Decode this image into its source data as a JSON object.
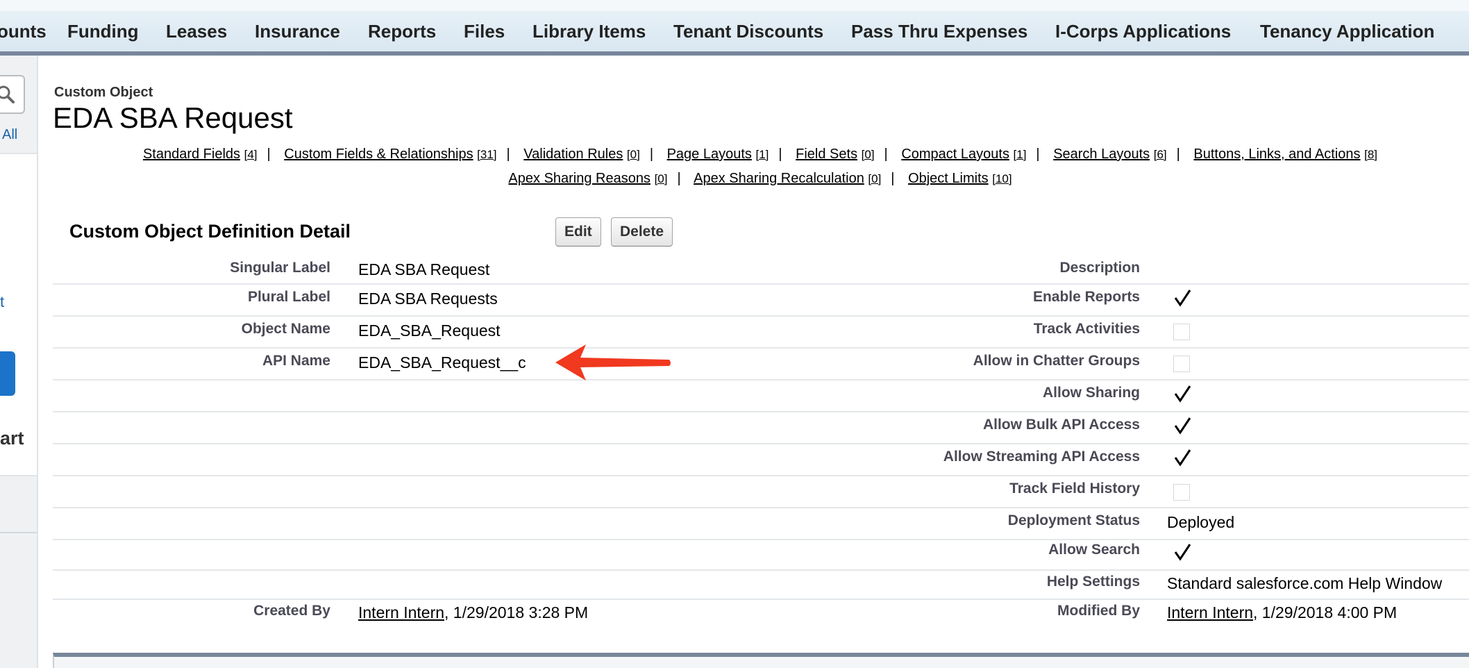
{
  "tabs": [
    "ounts",
    "Funding",
    "Leases",
    "Insurance",
    "Reports",
    "Files",
    "Library Items",
    "Tenant Discounts",
    "Pass Thru Expenses",
    "I-Corps Applications",
    "Tenancy Application"
  ],
  "sidebar": {
    "all_label": "All",
    "t_label": "t",
    "art_label": "art"
  },
  "header": {
    "crumb": "Custom Object",
    "title": "EDA SBA Request"
  },
  "related_links": [
    {
      "label": "Standard Fields",
      "count": "[4]"
    },
    {
      "label": "Custom Fields & Relationships",
      "count": "[31]"
    },
    {
      "label": "Validation Rules",
      "count": "[0]"
    },
    {
      "label": "Page Layouts",
      "count": "[1]"
    },
    {
      "label": "Field Sets",
      "count": "[0]"
    },
    {
      "label": "Compact Layouts",
      "count": "[1]"
    },
    {
      "label": "Search Layouts",
      "count": "[6]"
    },
    {
      "label": "Buttons, Links, and Actions",
      "count": "[8]"
    },
    {
      "label": "Apex Sharing Reasons",
      "count": "[0]"
    },
    {
      "label": "Apex Sharing Recalculation",
      "count": "[0]"
    },
    {
      "label": "Object Limits",
      "count": "[10]"
    }
  ],
  "detail": {
    "section_title": "Custom Object Definition Detail",
    "edit_label": "Edit",
    "delete_label": "Delete",
    "left": [
      {
        "label": "Singular Label",
        "value": "EDA SBA Request"
      },
      {
        "label": "Plural Label",
        "value": "EDA SBA Requests"
      },
      {
        "label": "Object Name",
        "value": "EDA_SBA_Request"
      },
      {
        "label": "API Name",
        "value": "EDA_SBA_Request__c"
      }
    ],
    "right": [
      {
        "label": "Description",
        "value": ""
      },
      {
        "label": "Enable Reports",
        "checked": true
      },
      {
        "label": "Track Activities",
        "checked": false
      },
      {
        "label": "Allow in Chatter Groups",
        "checked": false
      },
      {
        "label": "Allow Sharing",
        "checked": true
      },
      {
        "label": "Allow Bulk API Access",
        "checked": true
      },
      {
        "label": "Allow Streaming API Access",
        "checked": true
      },
      {
        "label": "Track Field History",
        "checked": false
      },
      {
        "label": "Deployment Status",
        "value": "Deployed"
      },
      {
        "label": "Allow Search",
        "checked": true
      },
      {
        "label": "Help Settings",
        "value": "Standard salesforce.com Help Window"
      }
    ],
    "created_by": {
      "label": "Created By",
      "user": "Intern Intern",
      "date": ", 1/29/2018 3:28 PM"
    },
    "modified_by": {
      "label": "Modified By",
      "user": "Intern Intern",
      "date": ", 1/29/2018 4:00 PM"
    }
  },
  "colors": {
    "tab_bar": "#d9e7f1",
    "tab_border": "#77869b",
    "annotation_arrow": "#f0391f",
    "link_blue": "#1a63a8"
  }
}
